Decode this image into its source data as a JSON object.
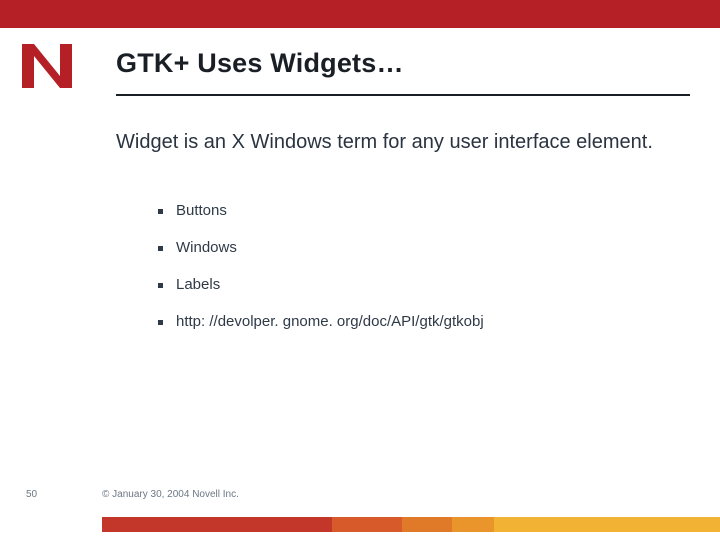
{
  "colors": {
    "brand_red": "#b42025",
    "text_dark": "#1a1f26",
    "text_body": "#2a3340",
    "footer_gradient": [
      "#c2372a",
      "#d75b2a",
      "#e07a28",
      "#e9952c",
      "#f2b233"
    ]
  },
  "logo": {
    "letter": "N"
  },
  "slide": {
    "title": "GTK+ Uses Widgets…",
    "lead": "Widget is an X Windows term for any user interface element.",
    "bullets": [
      "Buttons",
      "Windows",
      "Labels",
      "http: //devolper. gnome. org/doc/API/gtk/gtkobj"
    ]
  },
  "footer": {
    "page_number": "50",
    "copyright": "© January 30, 2004 Novell Inc."
  }
}
